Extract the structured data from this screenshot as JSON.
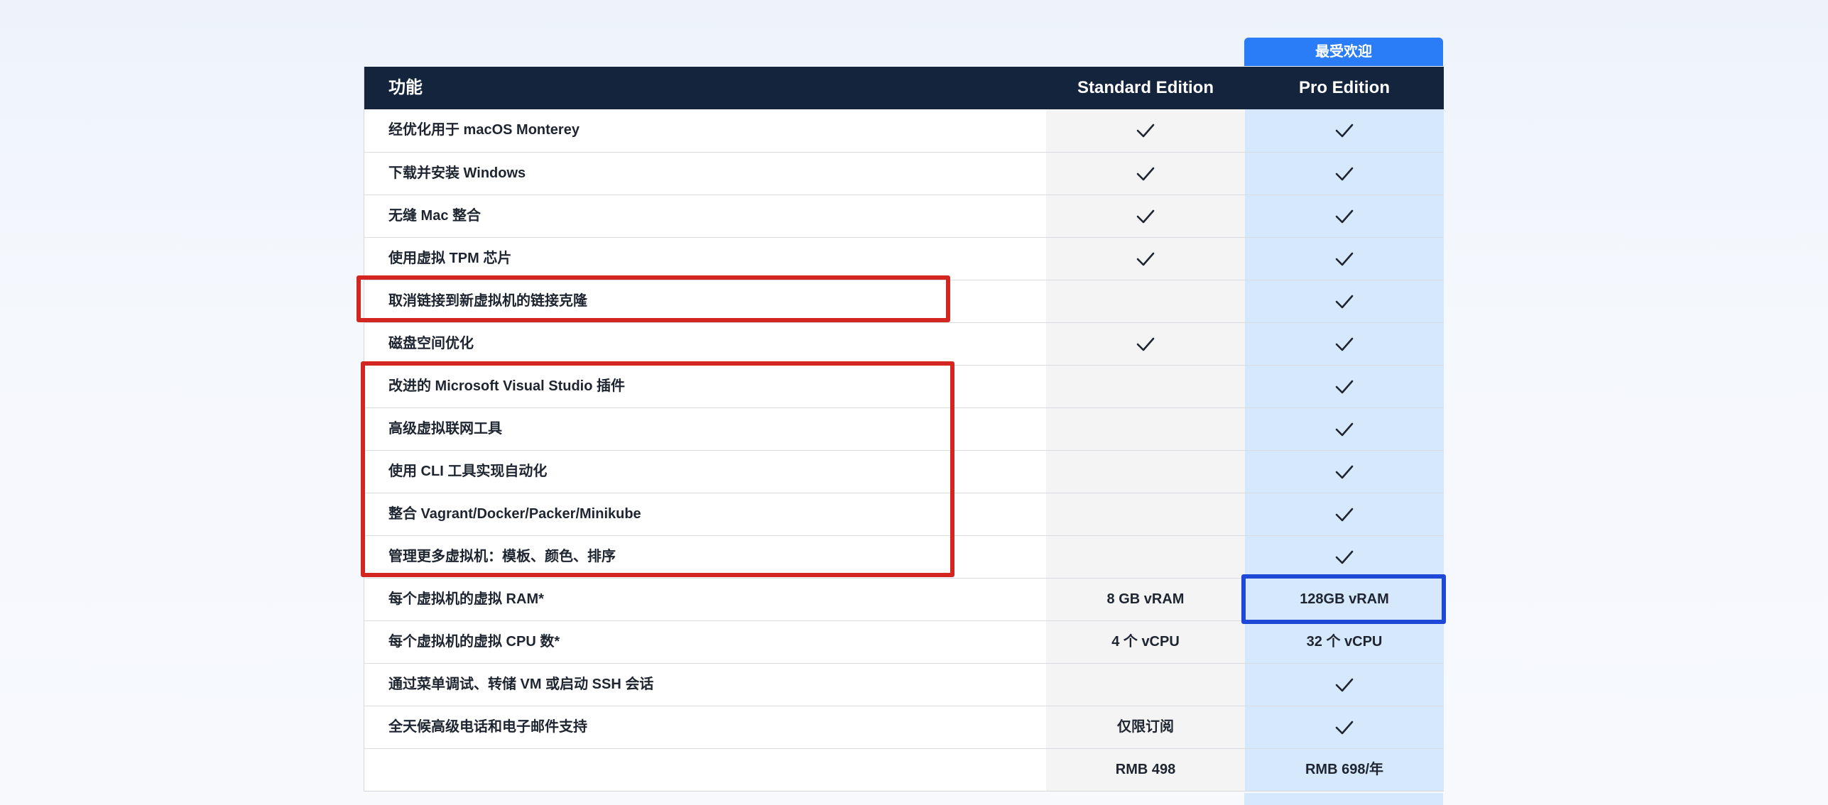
{
  "badge": "最受欢迎",
  "header": {
    "feature": "功能",
    "standard": "Standard Edition",
    "pro": "Pro Edition"
  },
  "rows": [
    {
      "feature": "经优化用于 macOS Monterey",
      "standard": "check",
      "pro": "check"
    },
    {
      "feature": "下载并安装 Windows",
      "standard": "check",
      "pro": "check"
    },
    {
      "feature": "无缝 Mac 整合",
      "standard": "check",
      "pro": "check"
    },
    {
      "feature": "使用虚拟 TPM 芯片",
      "standard": "check",
      "pro": "check"
    },
    {
      "feature": "取消链接到新虚拟机的链接克隆",
      "standard": "",
      "pro": "check"
    },
    {
      "feature": "磁盘空间优化",
      "standard": "check",
      "pro": "check"
    },
    {
      "feature": "改进的 Microsoft Visual Studio 插件",
      "standard": "",
      "pro": "check"
    },
    {
      "feature": "高级虚拟联网工具",
      "standard": "",
      "pro": "check"
    },
    {
      "feature": "使用 CLI 工具实现自动化",
      "standard": "",
      "pro": "check"
    },
    {
      "feature": "整合 Vagrant/Docker/Packer/Minikube",
      "standard": "",
      "pro": "check"
    },
    {
      "feature": "管理更多虚拟机：模板、颜色、排序",
      "standard": "",
      "pro": "check"
    },
    {
      "feature": "每个虚拟机的虚拟 RAM*",
      "standard": "8 GB vRAM",
      "pro": "128GB vRAM"
    },
    {
      "feature": "每个虚拟机的虚拟 CPU 数*",
      "standard": "4 个 vCPU",
      "pro": "32 个 vCPU"
    },
    {
      "feature": "通过菜单调试、转储 VM 或启动 SSH 会话",
      "standard": "",
      "pro": "check"
    },
    {
      "feature": "全天候高级电话和电子邮件支持",
      "standard": "仅限订阅",
      "pro": "check"
    },
    {
      "feature": "",
      "standard": "RMB 498",
      "pro": "RMB 698/年"
    }
  ],
  "colors": {
    "header_bg": "#13243c",
    "badge_bg": "#2b7df7",
    "pro_column_bg": "#d6e8fb",
    "standard_column_bg": "#f4f4f4",
    "highlight_red": "#d42620",
    "highlight_blue": "#1f48d6"
  }
}
